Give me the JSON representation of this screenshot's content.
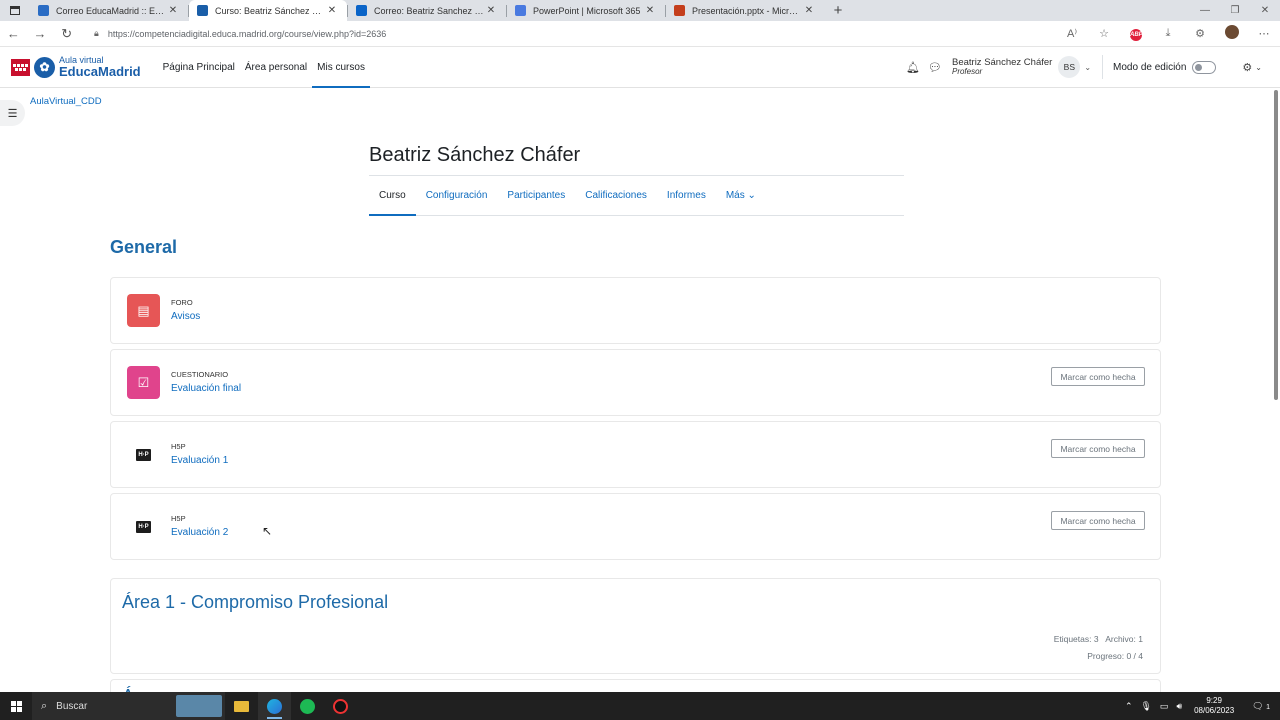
{
  "browser": {
    "tabs": [
      {
        "title": "Correo EducaMadrid :: Entrada",
        "favicon": "mail-icon",
        "color": "#2a6cc4",
        "active": false
      },
      {
        "title": "Curso: Beatriz Sánchez Cháfer",
        "favicon": "mortarboard-icon",
        "color": "#1a5ea8",
        "active": true
      },
      {
        "title": "Correo: Beatriz Sanchez Chafer -",
        "favicon": "outlook-icon",
        "color": "#0a64c8",
        "active": false
      },
      {
        "title": "PowerPoint | Microsoft 365",
        "favicon": "m365-icon",
        "color": "#4a7ae0",
        "active": false
      },
      {
        "title": "Presentación.pptx - Microsoft Po",
        "favicon": "powerpoint-icon",
        "color": "#c43e1c",
        "active": false
      }
    ],
    "url": "https://competenciadigital.educa.madrid.org/course/view.php?id=2636"
  },
  "site": {
    "logo_small": "Aula virtual",
    "logo_big": "EducaMadrid",
    "primary_nav": [
      "Página Principal",
      "Área personal",
      "Mis cursos"
    ],
    "primary_active": "Mis cursos",
    "user_name": "Beatriz Sánchez Cháfer",
    "user_role": "Profesor",
    "user_initials": "BS",
    "edit_mode_label": "Modo de edición"
  },
  "breadcrumb": "AulaVirtual_CDD",
  "course": {
    "title": "Beatriz Sánchez Cháfer",
    "tabs": [
      {
        "label": "Curso",
        "active": true
      },
      {
        "label": "Configuración",
        "active": false
      },
      {
        "label": "Participantes",
        "active": false
      },
      {
        "label": "Calificaciones",
        "active": false
      },
      {
        "label": "Informes",
        "active": false
      },
      {
        "label": "Más ⌄",
        "active": false
      }
    ]
  },
  "general_section": {
    "title": "General",
    "activities": [
      {
        "type": "FORO",
        "name": "Avisos",
        "icon": "forum-icon",
        "color": "#e65656",
        "mark_done": ""
      },
      {
        "type": "CUESTIONARIO",
        "name": "Evaluación final",
        "icon": "quiz-icon",
        "color": "#e0448c",
        "mark_done": "Marcar como hecha"
      },
      {
        "type": "H5P",
        "name": "Evaluación 1",
        "icon": "h5p-icon",
        "color": "#1d1d1d",
        "mark_done": "Marcar como hecha"
      },
      {
        "type": "H5P",
        "name": "Evaluación 2",
        "icon": "h5p-icon",
        "color": "#1d1d1d",
        "mark_done": "Marcar como hecha"
      }
    ]
  },
  "area1": {
    "title": "Área 1 - Compromiso Profesional",
    "meta_counts": "Etiquetas: 3   Archivo: 1",
    "progress": "Progreso: 0 / 4"
  },
  "next_section_partial": "Á",
  "taskbar": {
    "search_label": "Buscar",
    "time": "9:29",
    "date": "08/06/2023",
    "notifications": "1"
  }
}
